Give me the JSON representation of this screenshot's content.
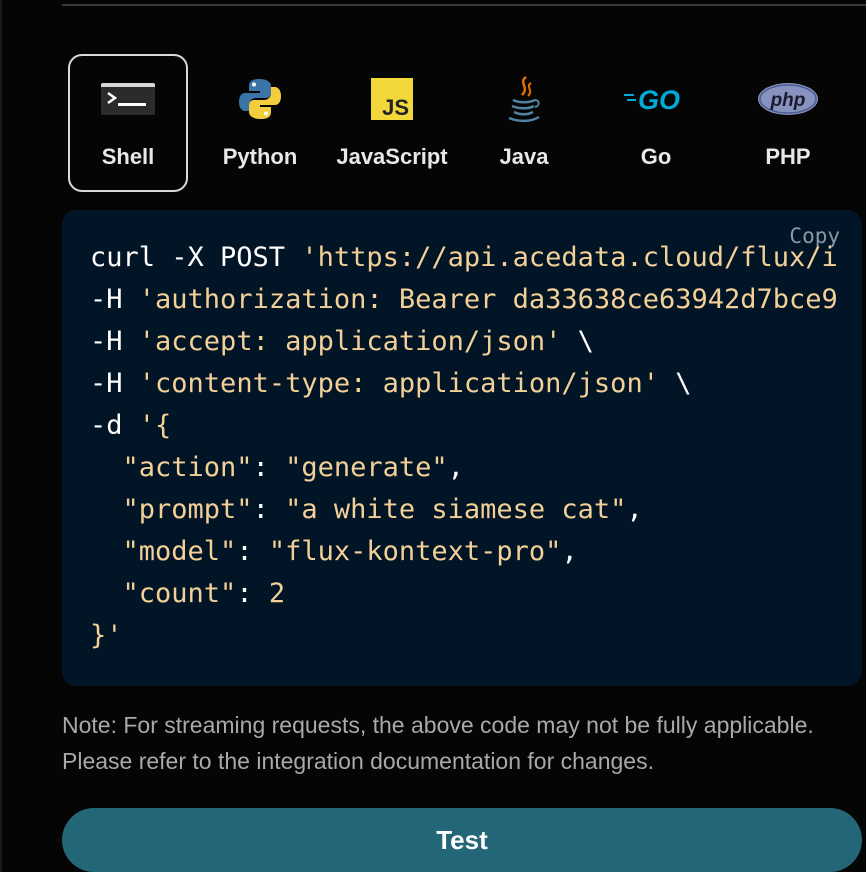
{
  "language_tabs": [
    {
      "id": "shell",
      "label": "Shell",
      "icon": "terminal-icon",
      "active": true
    },
    {
      "id": "python",
      "label": "Python",
      "icon": "python-icon",
      "active": false
    },
    {
      "id": "javascript",
      "label": "JavaScript",
      "icon": "javascript-icon",
      "active": false
    },
    {
      "id": "java",
      "label": "Java",
      "icon": "java-icon",
      "active": false
    },
    {
      "id": "go",
      "label": "Go",
      "icon": "go-icon",
      "active": false
    },
    {
      "id": "php",
      "label": "PHP",
      "icon": "php-icon",
      "active": false
    }
  ],
  "icons": {
    "js_text": "JS",
    "go_text": "GO",
    "php_text": "php"
  },
  "code_panel": {
    "copy_label": "Copy",
    "lines": {
      "l1_cmd": "curl -X POST ",
      "l1_url": "'https://api.acedata.cloud/flux/i",
      "l2_flag": "-H ",
      "l2_val": "'authorization: Bearer da33638ce63942d7bce9",
      "l3_flag": "-H ",
      "l3_val": "'accept: application/json'",
      "l3_end": " \\",
      "l4_flag": "-H ",
      "l4_val": "'content-type: application/json'",
      "l4_end": " \\",
      "l5_flag": "-d ",
      "l5_val": "'{",
      "l6_key": "\"action\"",
      "l6_val": "\"generate\"",
      "l7_key": "\"prompt\"",
      "l7_val": "\"a white siamese cat\"",
      "l8_key": "\"model\"",
      "l8_val": "\"flux-kontext-pro\"",
      "l9_key": "\"count\"",
      "l9_val": "2",
      "l10_val": "}'"
    }
  },
  "note": "Note: For streaming requests, the above code may not be fully applicable. Please refer to the integration documentation for changes.",
  "test_button_label": "Test",
  "colors": {
    "background": "#050505",
    "code_bg": "#021526",
    "string": "#f2d098",
    "button": "#226677"
  }
}
